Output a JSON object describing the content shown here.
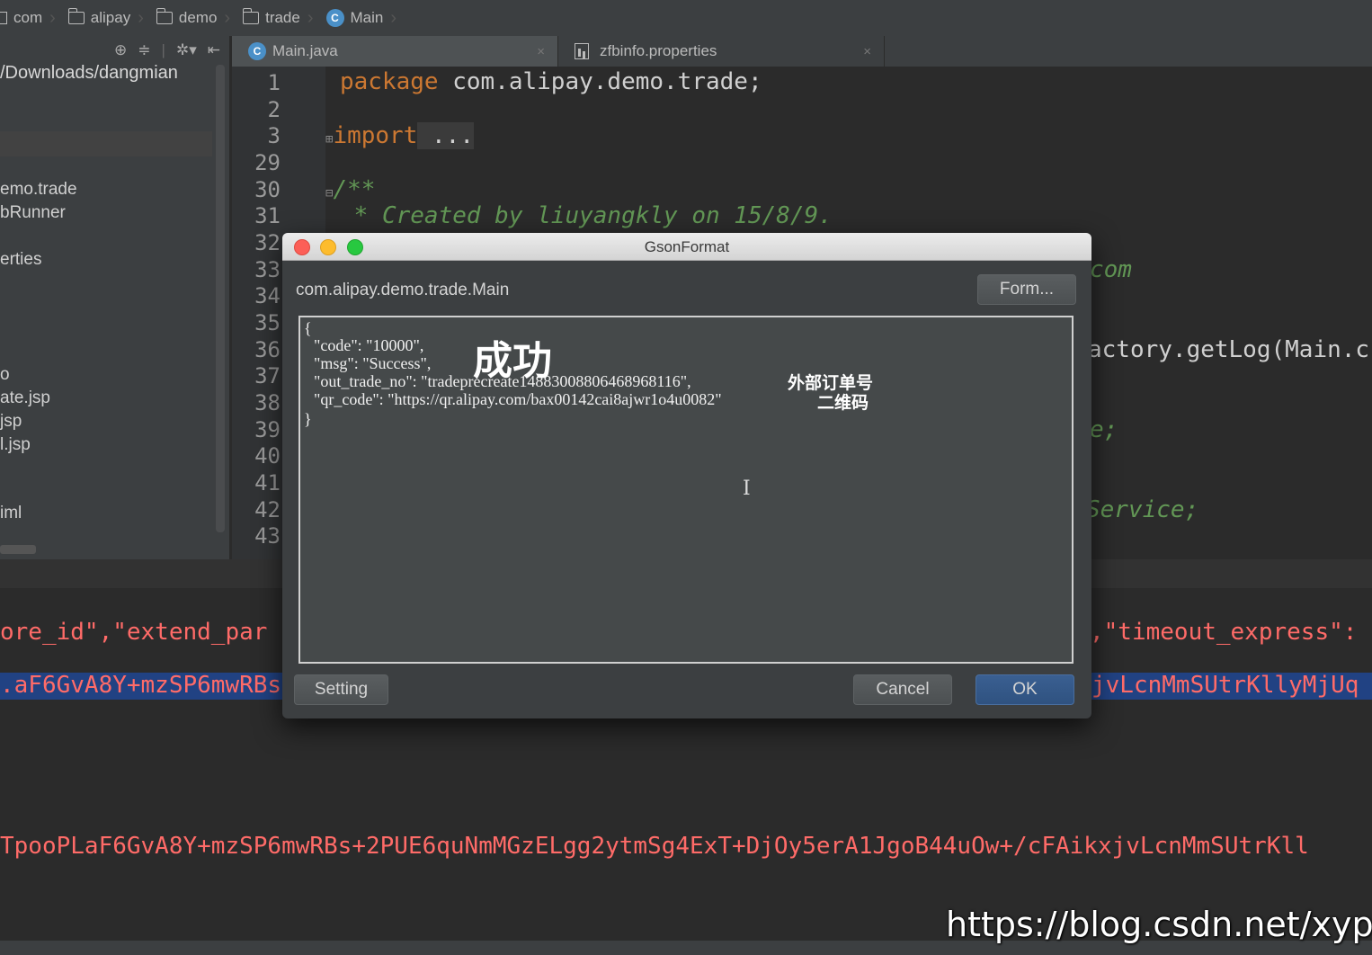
{
  "breadcrumb": [
    {
      "label": "com",
      "icon": "folder-icon"
    },
    {
      "label": "alipay",
      "icon": "folder-icon"
    },
    {
      "label": "demo",
      "icon": "folder-icon"
    },
    {
      "label": "trade",
      "icon": "folder-icon"
    },
    {
      "label": "Main",
      "icon": "class-icon"
    }
  ],
  "project": {
    "path": "/Downloads/dangmian",
    "items": [
      "emo.trade",
      "bRunner",
      "erties",
      "o",
      "ate.jsp",
      "jsp",
      "l.jsp",
      "iml"
    ]
  },
  "tabs": [
    {
      "label": "Main.java",
      "icon": "class-icon",
      "active": true,
      "close": "×"
    },
    {
      "label": "zfbinfo.properties",
      "icon": "properties-file-icon",
      "active": false,
      "close": "×"
    }
  ],
  "editor": {
    "line_numbers": [
      "1",
      "2",
      "3",
      "29",
      "30",
      "31",
      "32",
      "33",
      "34",
      "35",
      "36",
      "37",
      "38",
      "39",
      "40",
      "41",
      "42",
      "43"
    ],
    "line1_keyword": "package",
    "line1_rest": " com.alipay.demo.trade;",
    "line3_keyword": "import",
    "line3_rest": " ...",
    "line30": "/**",
    "line31": " * Created by liuyangkly on 15/8/9.",
    "frag_com": "com",
    "frag_getlog": "actory.getLog(Main.c",
    "frag_e": "e;",
    "frag_service": "Service;"
  },
  "console": {
    "line1_left": "ore_id\",\"extend_par",
    "line1_right": ",\"timeout_express\":",
    "line2_left": ".aF6GvA8Y+mzSP6mwRBs",
    "line2_right": "jvLcnMmSUtrKllyMjUq",
    "line3": "TpooPLaF6GvA8Y+mzSP6mwRBs+2PUE6quNmMGzELgg2ytmSg4ExT+DjOy5erA1JgoB44uOw+/cFAikxjvLcnMmSUtrKll"
  },
  "dialog": {
    "title": "GsonFormat",
    "class_name": "com.alipay.demo.trade.Main",
    "format_button": "Form...",
    "json_lines": [
      "{",
      "  \"code\": \"10000\",",
      "  \"msg\": \"Success\",",
      "  \"out_trade_no\": \"tradeprecreate14883008806468968116\",",
      "  \"qr_code\": \"https://qr.alipay.com/bax00142cai8ajwr1o4u0082\"",
      "}"
    ],
    "annotation_success": "成功",
    "annotation_order": "外部订单号",
    "annotation_qrcode": "二维码",
    "setting_button": "Setting",
    "cancel_button": "Cancel",
    "ok_button": "OK"
  },
  "watermark": "https://blog.csdn.net/xyphf",
  "colors": {
    "keyword": "#cc7832",
    "comment": "#629755",
    "console_error": "#ff6b68",
    "selection": "#214283"
  }
}
